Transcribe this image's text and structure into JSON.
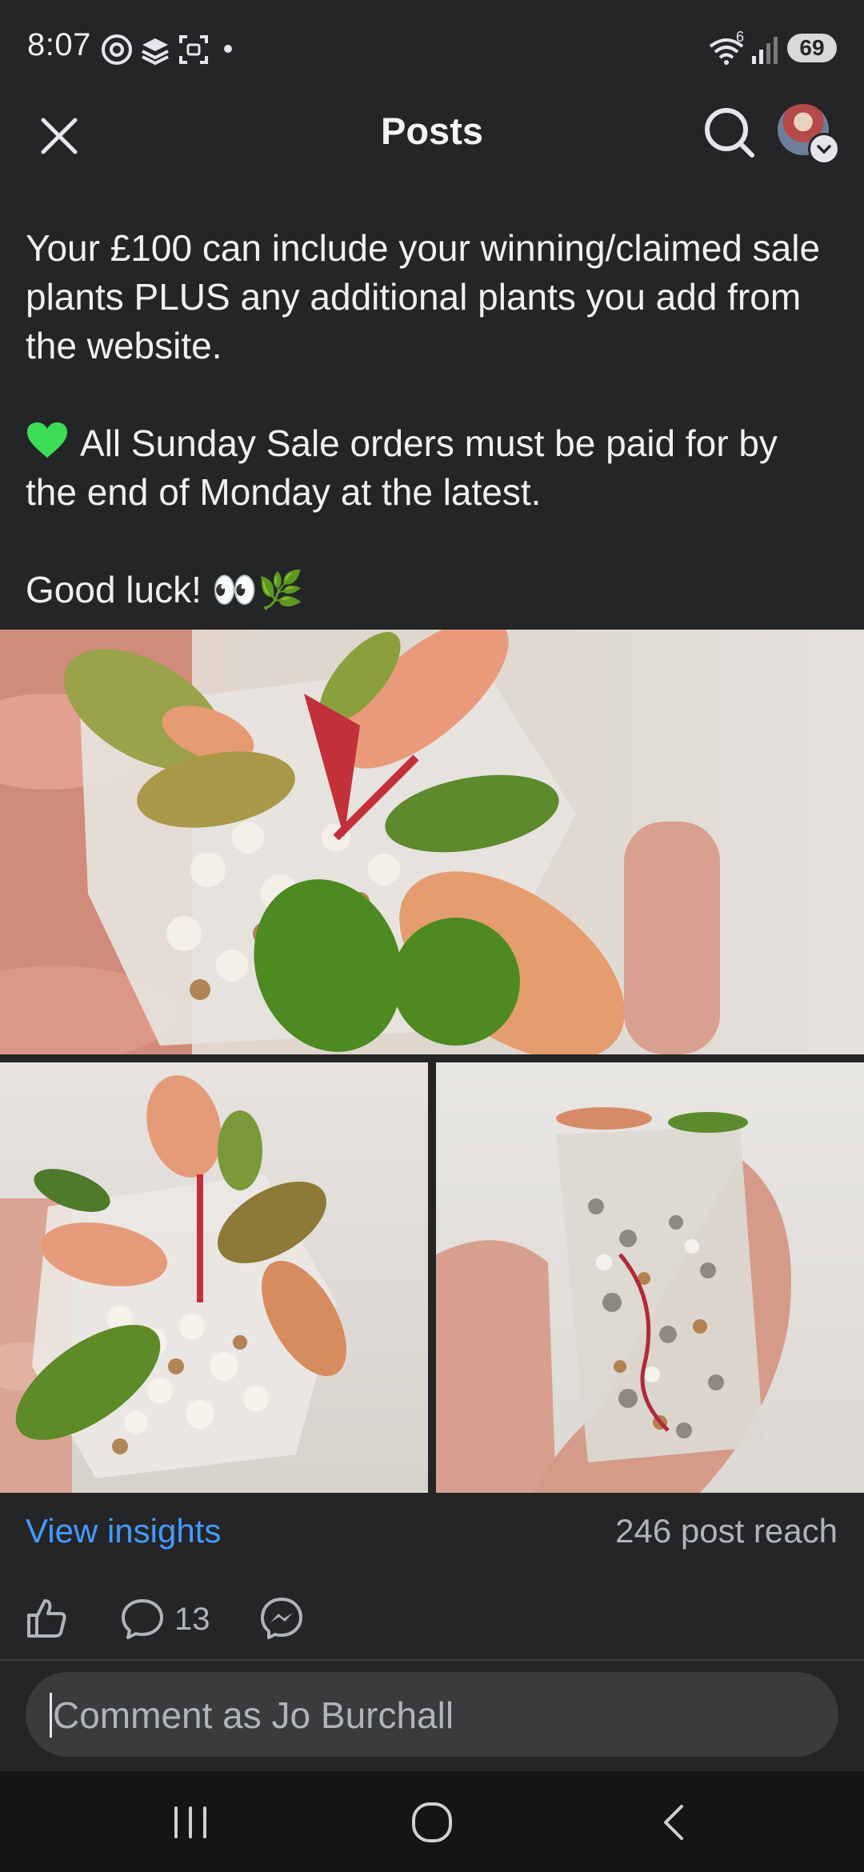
{
  "status_bar": {
    "time": "8:07",
    "left_icons": [
      "threads-icon",
      "layers-icon",
      "screenshot-icon",
      "dot-icon"
    ],
    "right_icons": [
      "wifi-icon",
      "signal-icon"
    ],
    "wifi_label": "6",
    "battery": "69"
  },
  "header": {
    "title": "Posts",
    "close_icon": "close-icon",
    "search_icon": "search-icon"
  },
  "post": {
    "text_line_1": "Your £100 can include your winning/claimed sale plants PLUS any additional plants you add from the website.",
    "text_line_2": "All Sunday Sale orders must be paid for by the end of Monday at the latest.",
    "text_line_3": "Good luck! 👀🌿",
    "heart_icon": "green-heart-icon",
    "photos": [
      "plant-photo-1",
      "plant-photo-2",
      "plant-photo-3"
    ]
  },
  "insights": {
    "link_label": "View insights",
    "reach_label": "246 post reach"
  },
  "actions": {
    "comment_count": "13"
  },
  "comment": {
    "placeholder": "Comment as Jo Burchall"
  },
  "colors": {
    "background": "#242526",
    "link": "#4599ff",
    "muted": "#b0b3b8",
    "heart": "#3ddc56"
  }
}
